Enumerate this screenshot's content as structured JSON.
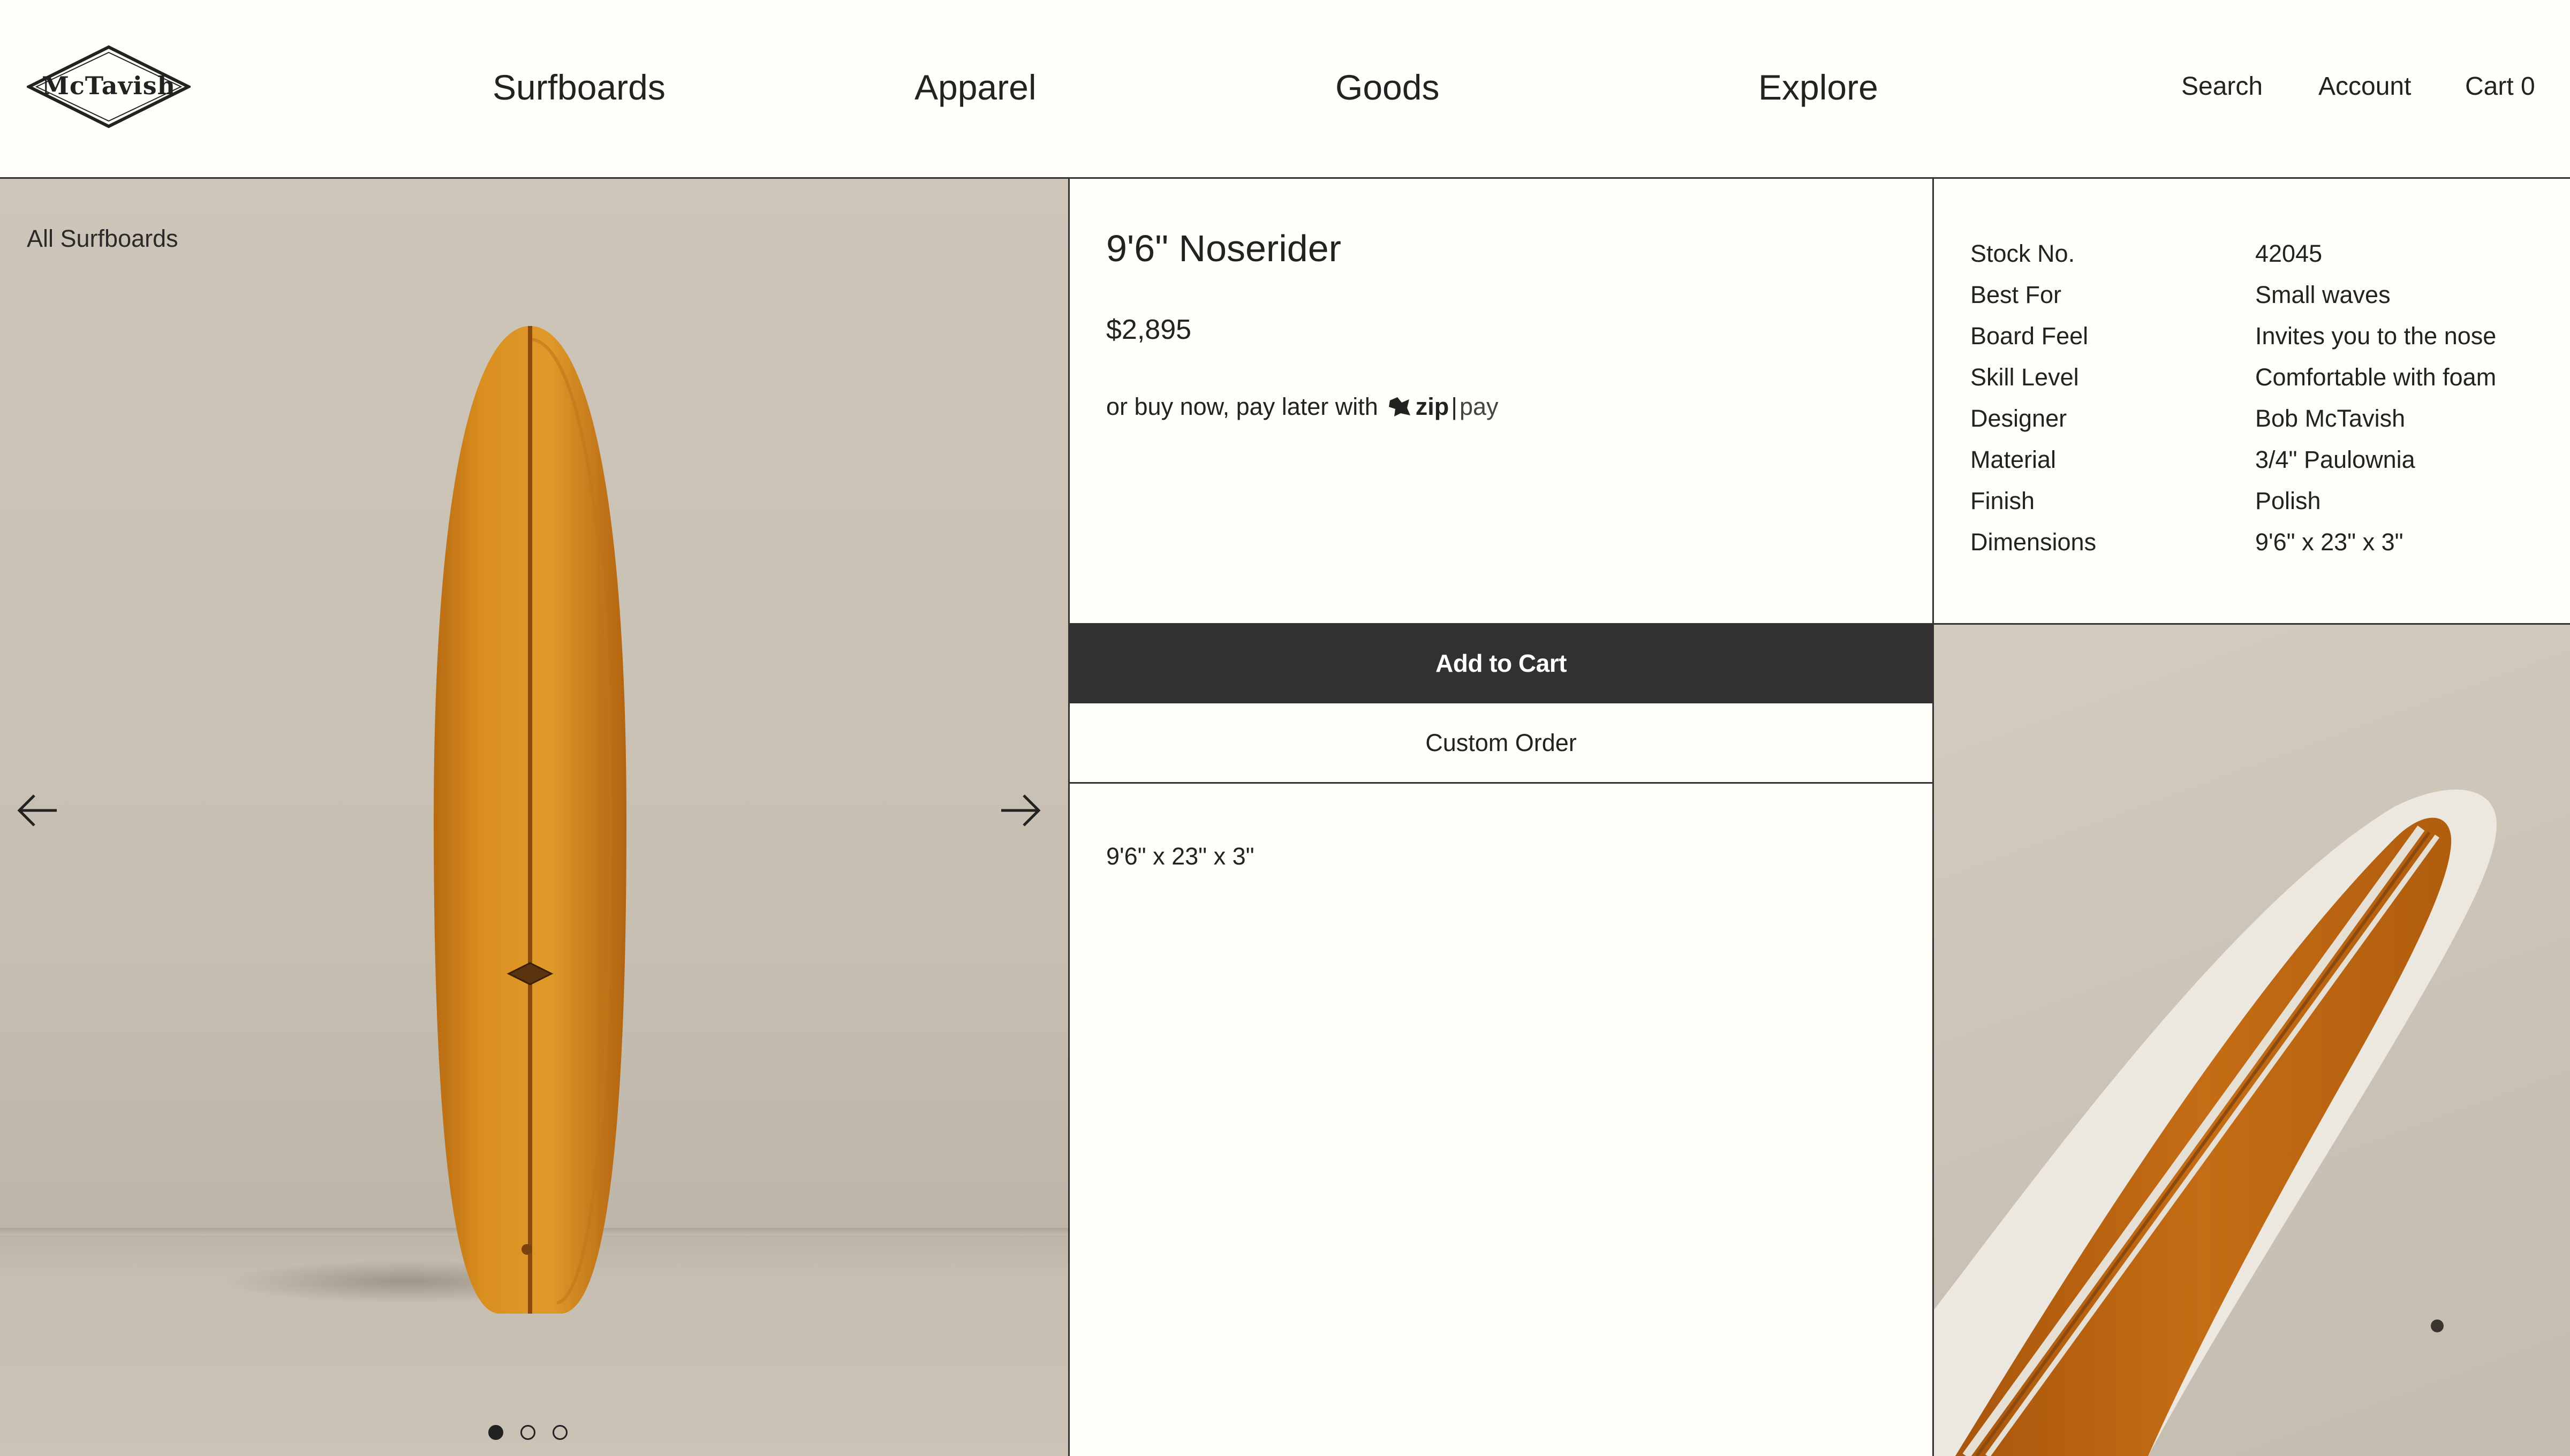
{
  "header": {
    "logo_text": "McTavish",
    "nav": [
      "Surfboards",
      "Apparel",
      "Goods",
      "Explore"
    ],
    "search_label": "Search",
    "account_label": "Account",
    "cart_label": "Cart 0"
  },
  "gallery": {
    "breadcrumb": "All Surfboards",
    "prev_icon": "arrow-left-icon",
    "next_icon": "arrow-right-icon",
    "slide_count": 3,
    "active_slide": 1,
    "board_color": "#d68a1c"
  },
  "product": {
    "title": "9'6\" Noserider",
    "price": "$2,895",
    "paylater_text": "or buy now, pay later with",
    "zip_brand": "zip",
    "zip_suffix": "pay",
    "add_to_cart_label": "Add to Cart",
    "custom_order_label": "Custom Order",
    "dimensions_text": "9'6\" x 23\" x 3\""
  },
  "specs": [
    {
      "label": "Stock No.",
      "value": "42045"
    },
    {
      "label": "Best For",
      "value": "Small waves"
    },
    {
      "label": "Board Feel",
      "value": "Invites you to the nose"
    },
    {
      "label": "Skill Level",
      "value": "Comfortable with foam"
    },
    {
      "label": "Designer",
      "value": "Bob McTavish"
    },
    {
      "label": "Material",
      "value": "3/4\" Paulownia"
    },
    {
      "label": "Finish",
      "value": "Polish"
    },
    {
      "label": "Dimensions",
      "value": "9'6\" x 23\" x 3\""
    }
  ],
  "colors": {
    "background": "#fffef8",
    "button_dark": "#333031",
    "text": "#222222",
    "wall": "#c8c0b2"
  }
}
